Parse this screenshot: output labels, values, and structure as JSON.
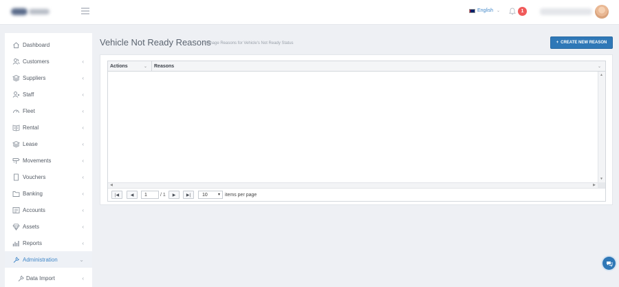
{
  "header": {
    "language": "English",
    "notification_count": "1"
  },
  "sidebar": {
    "items": [
      {
        "label": "Dashboard",
        "icon": "home-icon"
      },
      {
        "label": "Customers",
        "icon": "users-icon"
      },
      {
        "label": "Suppliers",
        "icon": "layers-icon"
      },
      {
        "label": "Staff",
        "icon": "staff-icon"
      },
      {
        "label": "Fleet",
        "icon": "speedometer-icon"
      },
      {
        "label": "Rental",
        "icon": "book-icon"
      },
      {
        "label": "Lease",
        "icon": "layers-icon"
      },
      {
        "label": "Movements",
        "icon": "signpost-icon"
      },
      {
        "label": "Vouchers",
        "icon": "voucher-icon"
      },
      {
        "label": "Banking",
        "icon": "folder-icon"
      },
      {
        "label": "Accounts",
        "icon": "ledger-icon"
      },
      {
        "label": "Assets",
        "icon": "diamond-icon"
      },
      {
        "label": "Reports",
        "icon": "bar-chart-icon"
      },
      {
        "label": "Administration",
        "icon": "wrench-icon"
      },
      {
        "label": "Data Import",
        "icon": "wrench-icon"
      }
    ]
  },
  "page": {
    "title": "Vehicle Not Ready Reasons",
    "subtitle": "Manage Reasons for Vehicle's Not Ready Status",
    "create_button": "CREATE NEW REASON"
  },
  "grid": {
    "columns": [
      "Actions",
      "Reasons"
    ],
    "rows": [],
    "pager": {
      "page": "1",
      "of_label": "/ 1",
      "page_size": "10",
      "items_per_page_label": "items per page"
    }
  },
  "colors": {
    "accent": "#2f78b7",
    "link": "#3f86c8",
    "badge": "#f05a5a"
  }
}
